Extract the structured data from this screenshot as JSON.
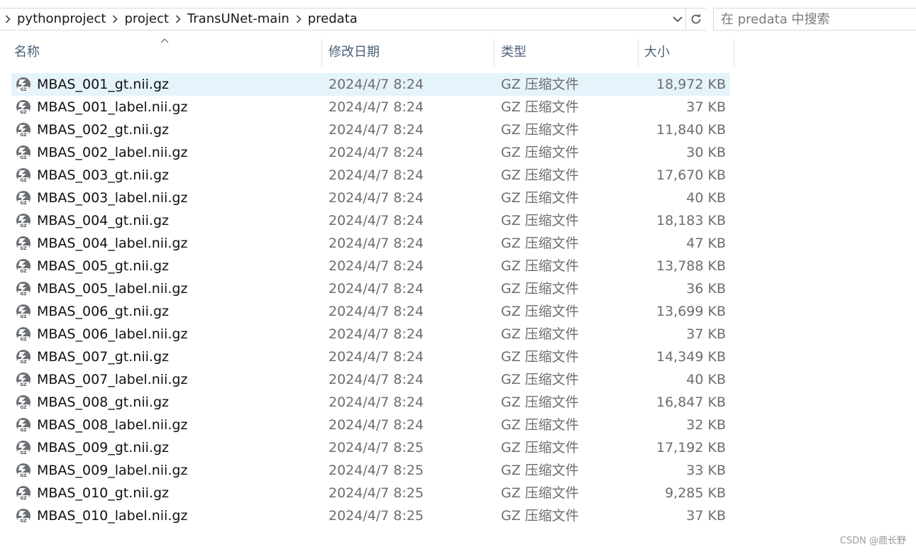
{
  "address": {
    "breadcrumbs": [
      "pythonproject",
      "project",
      "TransUNet-main",
      "predata"
    ]
  },
  "search": {
    "placeholder": "在 predata 中搜索"
  },
  "columns": {
    "name": "名称",
    "date": "修改日期",
    "type": "类型",
    "size": "大小"
  },
  "sort": {
    "column": "name",
    "direction": "ascending"
  },
  "files": [
    {
      "name": "MBAS_001_gt.nii.gz",
      "date": "2024/4/7 8:24",
      "type": "GZ 压缩文件",
      "size": "18,972 KB",
      "selected": true
    },
    {
      "name": "MBAS_001_label.nii.gz",
      "date": "2024/4/7 8:24",
      "type": "GZ 压缩文件",
      "size": "37 KB"
    },
    {
      "name": "MBAS_002_gt.nii.gz",
      "date": "2024/4/7 8:24",
      "type": "GZ 压缩文件",
      "size": "11,840 KB"
    },
    {
      "name": "MBAS_002_label.nii.gz",
      "date": "2024/4/7 8:24",
      "type": "GZ 压缩文件",
      "size": "30 KB"
    },
    {
      "name": "MBAS_003_gt.nii.gz",
      "date": "2024/4/7 8:24",
      "type": "GZ 压缩文件",
      "size": "17,670 KB"
    },
    {
      "name": "MBAS_003_label.nii.gz",
      "date": "2024/4/7 8:24",
      "type": "GZ 压缩文件",
      "size": "40 KB"
    },
    {
      "name": "MBAS_004_gt.nii.gz",
      "date": "2024/4/7 8:24",
      "type": "GZ 压缩文件",
      "size": "18,183 KB"
    },
    {
      "name": "MBAS_004_label.nii.gz",
      "date": "2024/4/7 8:24",
      "type": "GZ 压缩文件",
      "size": "47 KB"
    },
    {
      "name": "MBAS_005_gt.nii.gz",
      "date": "2024/4/7 8:24",
      "type": "GZ 压缩文件",
      "size": "13,788 KB"
    },
    {
      "name": "MBAS_005_label.nii.gz",
      "date": "2024/4/7 8:24",
      "type": "GZ 压缩文件",
      "size": "36 KB"
    },
    {
      "name": "MBAS_006_gt.nii.gz",
      "date": "2024/4/7 8:24",
      "type": "GZ 压缩文件",
      "size": "13,699 KB"
    },
    {
      "name": "MBAS_006_label.nii.gz",
      "date": "2024/4/7 8:24",
      "type": "GZ 压缩文件",
      "size": "37 KB"
    },
    {
      "name": "MBAS_007_gt.nii.gz",
      "date": "2024/4/7 8:24",
      "type": "GZ 压缩文件",
      "size": "14,349 KB"
    },
    {
      "name": "MBAS_007_label.nii.gz",
      "date": "2024/4/7 8:24",
      "type": "GZ 压缩文件",
      "size": "40 KB"
    },
    {
      "name": "MBAS_008_gt.nii.gz",
      "date": "2024/4/7 8:24",
      "type": "GZ 压缩文件",
      "size": "16,847 KB"
    },
    {
      "name": "MBAS_008_label.nii.gz",
      "date": "2024/4/7 8:24",
      "type": "GZ 压缩文件",
      "size": "32 KB"
    },
    {
      "name": "MBAS_009_gt.nii.gz",
      "date": "2024/4/7 8:25",
      "type": "GZ 压缩文件",
      "size": "17,192 KB"
    },
    {
      "name": "MBAS_009_label.nii.gz",
      "date": "2024/4/7 8:25",
      "type": "GZ 压缩文件",
      "size": "33 KB"
    },
    {
      "name": "MBAS_010_gt.nii.gz",
      "date": "2024/4/7 8:25",
      "type": "GZ 压缩文件",
      "size": "9,285 KB"
    },
    {
      "name": "MBAS_010_label.nii.gz",
      "date": "2024/4/7 8:25",
      "type": "GZ 压缩文件",
      "size": "37 KB"
    }
  ],
  "icons": {
    "file": "gz-archive-icon",
    "address_dropdown": "chevron-down-icon",
    "refresh": "refresh-icon",
    "breadcrumb_separator": "chevron-right-icon"
  },
  "colors": {
    "selection": "#e5f3fb",
    "header_text": "#4c607a",
    "meta_text": "#6d6d6d"
  },
  "watermark": "CSDN @鹿长野"
}
